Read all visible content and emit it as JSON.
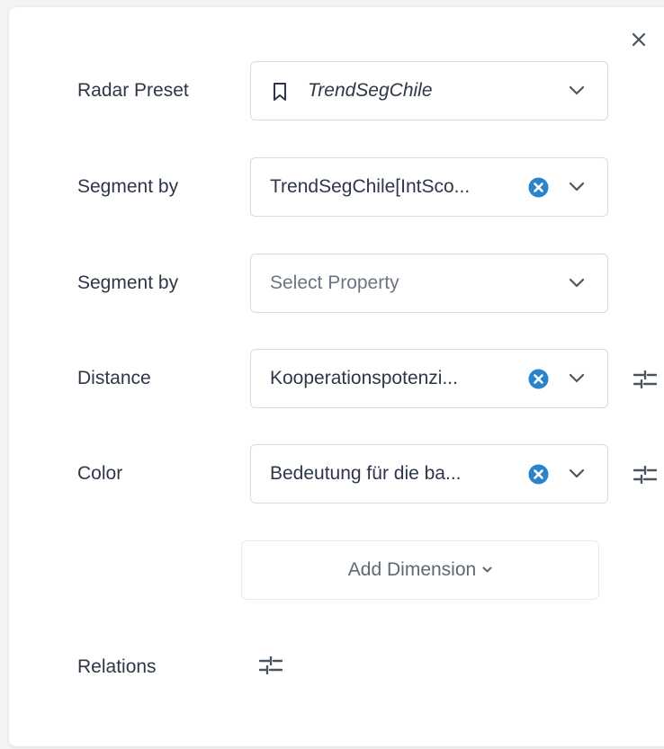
{
  "panel": {
    "close_label": "×"
  },
  "rows": [
    {
      "label": "Radar Preset",
      "value": "TrendSegChile",
      "type": "preset",
      "icon": "bookmark-icon"
    },
    {
      "label": "Segment by",
      "value": "TrendSegChile[IntSco...",
      "type": "selected",
      "clearable": true
    },
    {
      "label": "Segment by",
      "value": "",
      "placeholder": "Select Property",
      "type": "placeholder"
    },
    {
      "label": "Distance",
      "value": "Kooperationspotenzi...",
      "type": "selected",
      "clearable": true,
      "settings": true
    },
    {
      "label": "Color",
      "value": "Bedeutung für die ba...",
      "type": "selected",
      "clearable": true,
      "settings": true
    }
  ],
  "add_dimension": {
    "label": "Add Dimension"
  },
  "relations": {
    "label": "Relations"
  },
  "colors": {
    "accent": "#2b83c9",
    "text": "#2d3748",
    "placeholder": "#6b7682",
    "border": "#d6dbe1"
  }
}
